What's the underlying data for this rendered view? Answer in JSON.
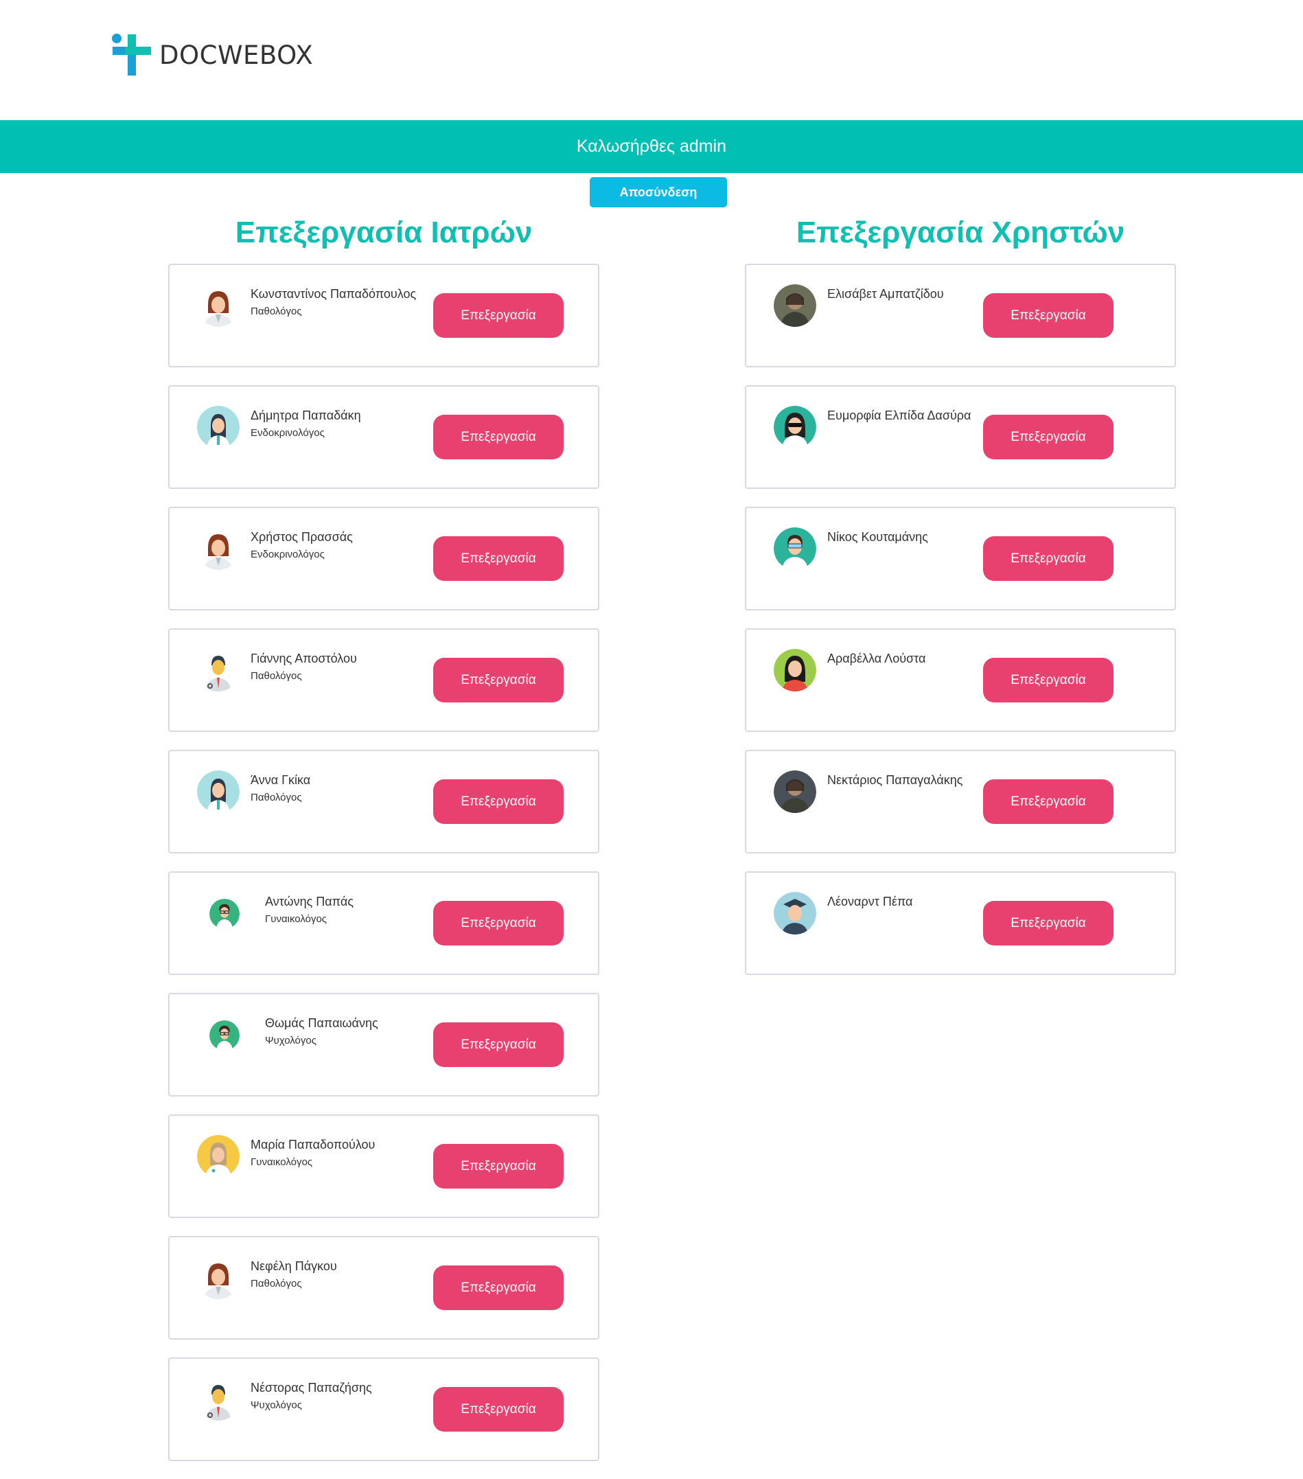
{
  "brand": {
    "name": "DOCWEBOX"
  },
  "header": {
    "welcome": "Καλωσήρθες admin",
    "logout_label": "Αποσύνδεση"
  },
  "doctors": {
    "title": "Επεξεργασία Ιατρών",
    "edit_label": "Επεξεργασία",
    "items": [
      {
        "name": "Κωνσταντίνος Παπαδόπουλος",
        "specialty": "Παθολόγος",
        "avatar": "female-doctor-brown-hair",
        "bg": "#ffffff"
      },
      {
        "name": "Δήμητρα Παπαδάκη",
        "specialty": "Ενδοκρινολόγος",
        "avatar": "female-doctor-teal",
        "bg": "#a7dfe2"
      },
      {
        "name": "Χρήστος Πρασσάς",
        "specialty": "Ενδοκρινολόγος",
        "avatar": "female-doctor-brown-hair",
        "bg": "#ffffff"
      },
      {
        "name": "Γιάννης Αποστόλου",
        "specialty": "Παθολόγος",
        "avatar": "male-doctor-stethoscope",
        "bg": "#ffffff"
      },
      {
        "name": "Άννα Γκίκα",
        "specialty": "Παθολόγος",
        "avatar": "female-doctor-teal",
        "bg": "#a7dfe2"
      },
      {
        "name": "Αντώνης Παπάς",
        "specialty": "Γυναικολόγος",
        "avatar": "male-doctor-glasses-green",
        "bg": "#36b37e"
      },
      {
        "name": "Θωμάς Παπαιωάνης",
        "specialty": "Ψυχολόγος",
        "avatar": "male-doctor-glasses-green",
        "bg": "#36b37e"
      },
      {
        "name": "Μαρία Παπαδοπούλου",
        "specialty": "Γυναικολόγος",
        "avatar": "female-doctor-yellow",
        "bg": "#f6c945"
      },
      {
        "name": "Νεφέλη Πάγκου",
        "specialty": "Παθολόγος",
        "avatar": "female-doctor-brown-hair",
        "bg": "#ffffff"
      },
      {
        "name": "Νέστορας Παπαζήσης",
        "specialty": "Ψυχολόγος",
        "avatar": "male-doctor-stethoscope",
        "bg": "#ffffff"
      }
    ]
  },
  "users": {
    "title": "Επεξεργασία Χρηστών",
    "edit_label": "Επεξεργασία",
    "items": [
      {
        "name": "Ελισάβετ Αμπατζίδου",
        "avatar": "photo-user",
        "bg": "#6b6f5a"
      },
      {
        "name": "Ευμορφία Ελπίδα Δασύρα",
        "avatar": "female-user-sunglasses-teal",
        "bg": "#2bb39c"
      },
      {
        "name": "Νίκος Κουταμάνης",
        "avatar": "male-user-glasses-teal",
        "bg": "#2bb39c"
      },
      {
        "name": "Αραβέλλα Λούστα",
        "avatar": "female-user-lime",
        "bg": "#9ccc4a"
      },
      {
        "name": "Νεκτάριος Παπαγαλάκης",
        "avatar": "photo-user",
        "bg": "#4a5058"
      },
      {
        "name": "Λέοναρντ Πέπα",
        "avatar": "graduate-user-light-blue",
        "bg": "#9fd3e0"
      }
    ]
  }
}
